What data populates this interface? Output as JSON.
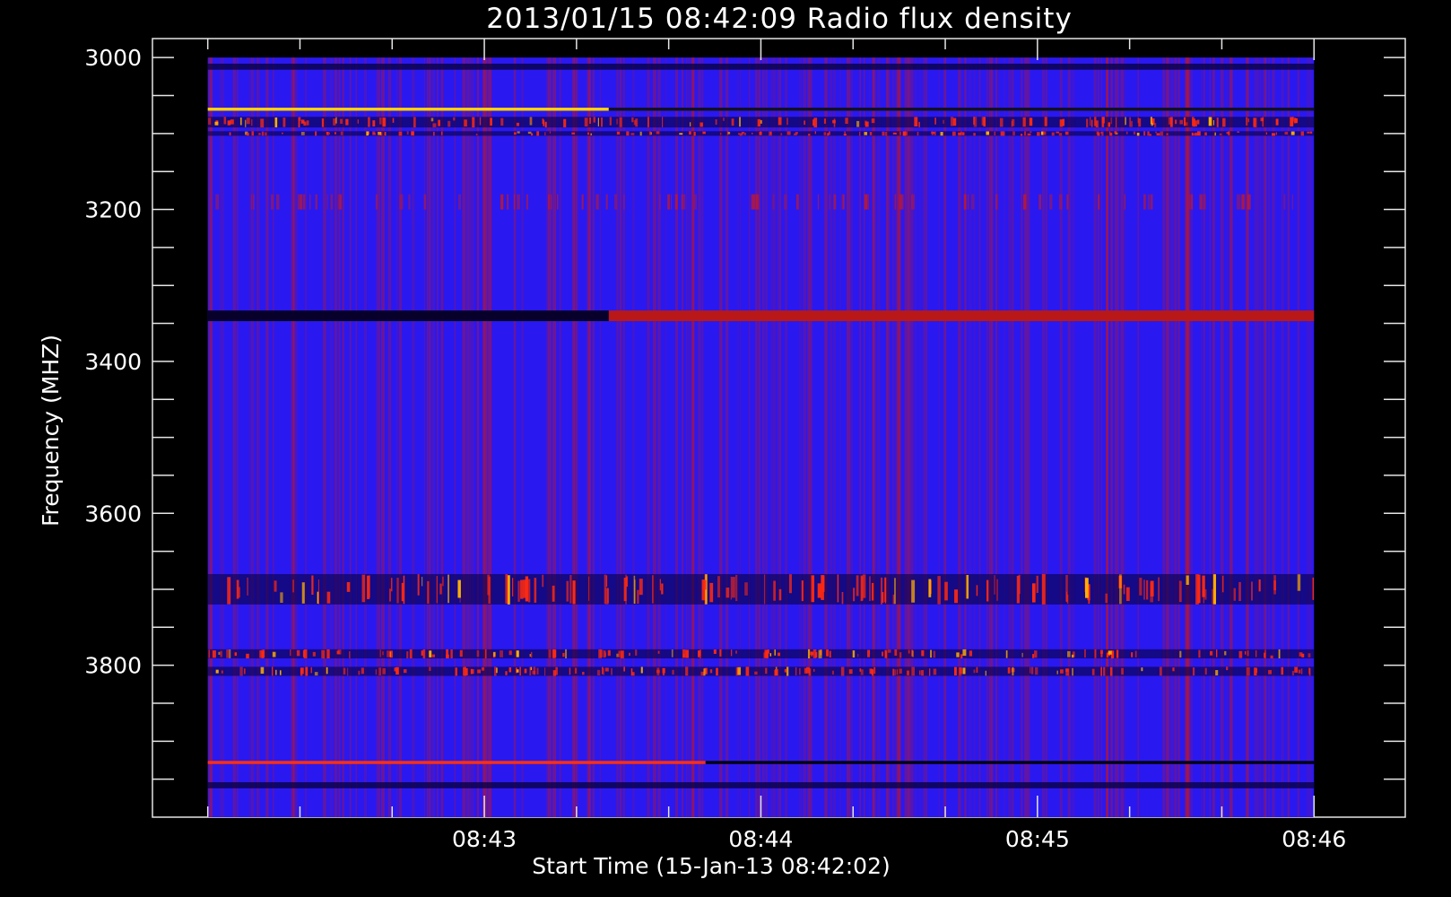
{
  "chart_data": {
    "type": "heatmap",
    "title": "2013/01/15 08:42:09 Radio flux density",
    "xlabel": "Start Time (15-Jan-13 08:42:02)",
    "ylabel": "Frequency (MHZ)",
    "x_ticks": [
      "08:43",
      "08:44",
      "08:45",
      "08:46"
    ],
    "x_tick_minutes": [
      1,
      2,
      3,
      4
    ],
    "x_range_minutes": [
      -0.2,
      4.33
    ],
    "x_data_range_minutes": [
      0.0,
      4.0
    ],
    "y_ticks": [
      "3000",
      "3200",
      "3400",
      "3600",
      "3800"
    ],
    "y_tick_values": [
      3000,
      3200,
      3400,
      3600,
      3800
    ],
    "y_minor_step": 50,
    "y_range": [
      2975,
      4000
    ],
    "y_data_range": [
      3000,
      4000
    ],
    "y_reversed": true,
    "colormap": [
      "#000000",
      "#1a00ff",
      "#ff1a00",
      "#ffcc00"
    ],
    "background_color": "#2a18f0",
    "frequency_bands_mhz": [
      {
        "freq": 3012,
        "width": 8,
        "type": "dark"
      },
      {
        "freq": 3068,
        "width": 4,
        "type": "bright_then_dark",
        "switch_minute": 1.45
      },
      {
        "freq": 3085,
        "width": 14,
        "type": "dark_red"
      },
      {
        "freq": 3100,
        "width": 6,
        "type": "dark_red"
      },
      {
        "freq": 3190,
        "width": 20,
        "type": "faint_red"
      },
      {
        "freq": 3340,
        "width": 14,
        "type": "dark_then_red",
        "switch_minute": 1.45
      },
      {
        "freq": 3700,
        "width": 40,
        "type": "dark_red"
      },
      {
        "freq": 3785,
        "width": 12,
        "type": "dark_red"
      },
      {
        "freq": 3808,
        "width": 12,
        "type": "dark_red"
      },
      {
        "freq": 3928,
        "width": 4,
        "type": "red_then_dark",
        "switch_minute": 1.8
      },
      {
        "freq": 3958,
        "width": 8,
        "type": "dark"
      }
    ]
  }
}
